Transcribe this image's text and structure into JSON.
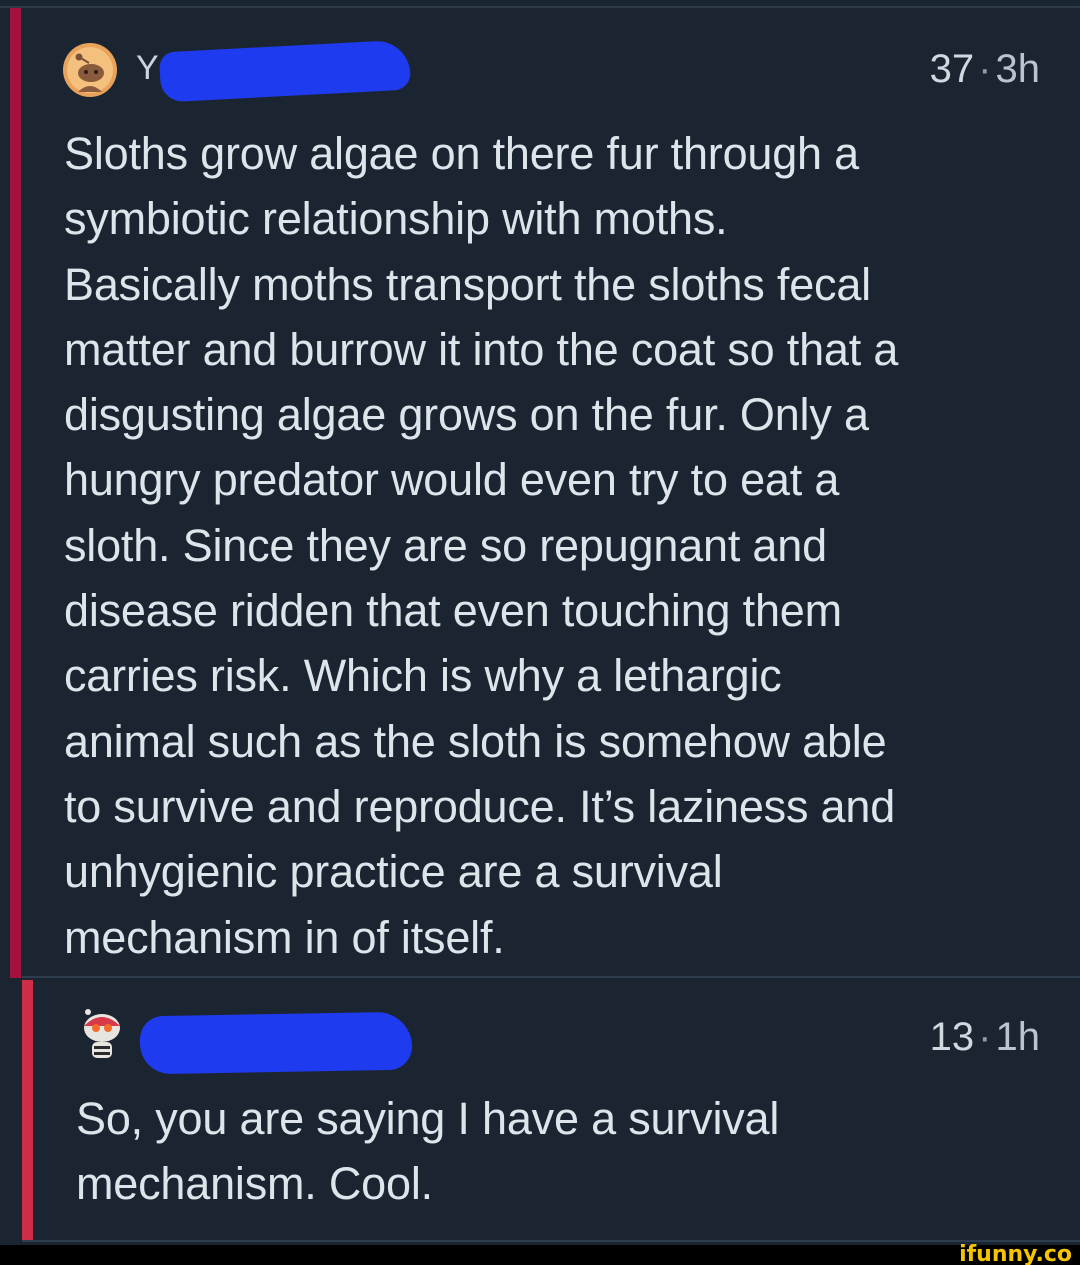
{
  "comments": [
    {
      "username_visible": "Y",
      "score": "37",
      "separator": "·",
      "age": "3h",
      "avatar": "snoo-avatar-icon",
      "lines": [
        "Sloths grow algae on there fur through a",
        "symbiotic relationship with moths.",
        "Basically moths transport the sloths fecal",
        "matter and burrow it into the coat so that a",
        "disgusting algae grows on the fur. Only a",
        "hungry predator would even try to eat a",
        "sloth. Since they are so repugnant and",
        "disease ridden that even touching them",
        "carries risk. Which is why a lethargic",
        "animal such as the sloth is somehow able",
        "to survive and reproduce. It’s laziness and",
        "unhygienic practice are a survival",
        "mechanism in of itself."
      ]
    },
    {
      "username_visible": "",
      "score": "13",
      "separator": "·",
      "age": "1h",
      "avatar": "snoo-avatar-icon",
      "lines": [
        "So, you are saying I have a survival",
        "mechanism. Cool."
      ]
    }
  ],
  "watermark": "ifunny.co",
  "colors": {
    "background": "#1b2532",
    "thread_bar_1": "#a3123f",
    "thread_bar_2": "#cf2c48",
    "redaction": "#1f3bf0",
    "watermark": "#f4c400"
  }
}
